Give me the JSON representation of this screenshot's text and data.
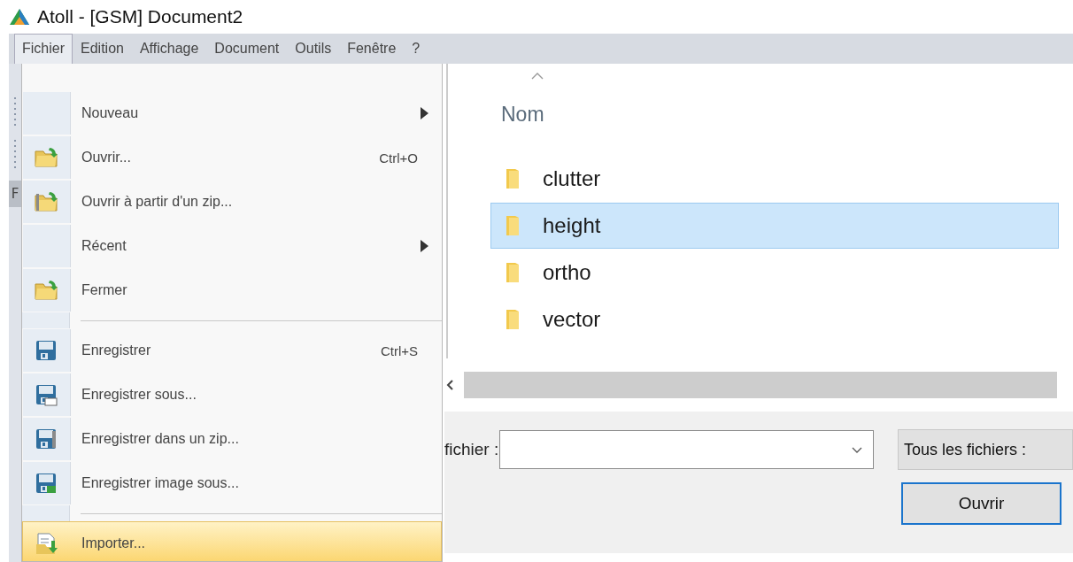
{
  "window": {
    "title": "Atoll - [GSM] Document2"
  },
  "menu_bar": [
    {
      "label": "Fichier",
      "selected": true
    },
    {
      "label": "Edition",
      "selected": false
    },
    {
      "label": "Affichage",
      "selected": false
    },
    {
      "label": "Document",
      "selected": false
    },
    {
      "label": "Outils",
      "selected": false
    },
    {
      "label": "Fenêtre",
      "selected": false
    },
    {
      "label": "?",
      "selected": false
    }
  ],
  "left_strip": {
    "tab_label": "F"
  },
  "file_menu": [
    {
      "kind": "item",
      "label": "Nouveau",
      "submenu": true,
      "selected": false
    },
    {
      "kind": "item",
      "label": "Ouvrir...",
      "shortcut": "Ctrl+O",
      "selected": false
    },
    {
      "kind": "item",
      "label": "Ouvrir à partir d'un zip...",
      "selected": false
    },
    {
      "kind": "item",
      "label": "Récent",
      "submenu": true,
      "selected": false
    },
    {
      "kind": "item",
      "label": "Fermer",
      "selected": false
    },
    {
      "kind": "separator"
    },
    {
      "kind": "item",
      "label": "Enregistrer",
      "shortcut": "Ctrl+S",
      "selected": false
    },
    {
      "kind": "item",
      "label": "Enregistrer sous...",
      "selected": false
    },
    {
      "kind": "item",
      "label": "Enregistrer dans un zip...",
      "selected": false
    },
    {
      "kind": "item",
      "label": "Enregistrer image sous...",
      "selected": false
    },
    {
      "kind": "separator"
    },
    {
      "kind": "item",
      "label": "Importer...",
      "selected": true
    }
  ],
  "file_dialog": {
    "column_header": "Nom",
    "folders": [
      {
        "name": "clutter",
        "selected": false
      },
      {
        "name": "height",
        "selected": true
      },
      {
        "name": "ortho",
        "selected": false
      },
      {
        "name": "vector",
        "selected": false
      }
    ],
    "file_name_label": "fichier :",
    "file_type_button": "Tous les fichiers :",
    "open_button": "Ouvrir"
  }
}
